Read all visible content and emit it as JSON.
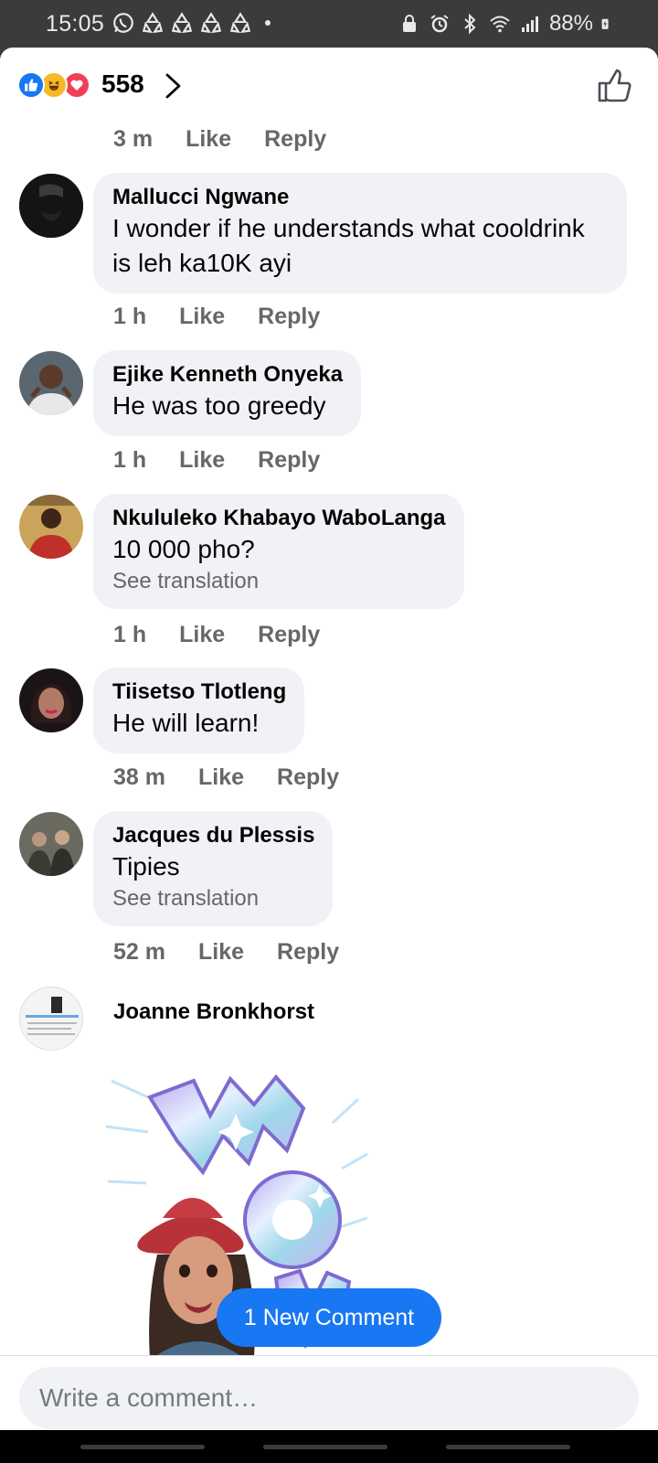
{
  "status_bar": {
    "time": "15:05",
    "battery": "88%"
  },
  "reactions": {
    "count": "558",
    "types": [
      "like",
      "haha",
      "love"
    ]
  },
  "prev_comment_meta": {
    "time": "3 m",
    "like": "Like",
    "reply": "Reply"
  },
  "comments": [
    {
      "author": "Mallucci Ngwane",
      "text": "I wonder if he understands what cooldrink is leh ka10K ayi",
      "time": "1 h",
      "like": "Like",
      "reply": "Reply"
    },
    {
      "author": "Ejike Kenneth Onyeka",
      "text": "He was too greedy",
      "time": "1 h",
      "like": "Like",
      "reply": "Reply"
    },
    {
      "author": "Nkululeko Khabayo WaboLanga",
      "text": "10 000 pho?",
      "see_translation": "See translation",
      "time": "1 h",
      "like": "Like",
      "reply": "Reply"
    },
    {
      "author": "Tiisetso Tlotleng",
      "text": "He will learn!",
      "time": "38 m",
      "like": "Like",
      "reply": "Reply"
    },
    {
      "author": "Jacques du Plessis",
      "text": "Tipies",
      "see_translation": "See translation",
      "time": "52 m",
      "like": "Like",
      "reply": "Reply"
    },
    {
      "author": "Joanne Bronkhorst",
      "sticker": "wow-avatar-sticker"
    }
  ],
  "new_comment_button": "1 New Comment",
  "composer": {
    "placeholder": "Write a comment…"
  },
  "colors": {
    "accent": "#1877f2",
    "bubble": "#f0f2f5",
    "meta": "#65676b"
  }
}
